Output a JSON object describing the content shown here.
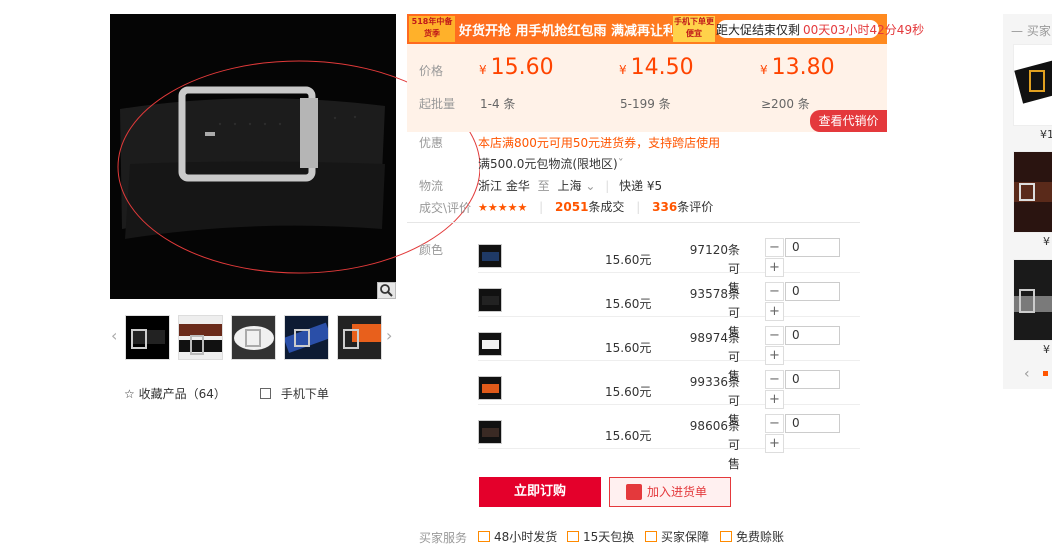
{
  "gallery": {
    "thumbnails": [
      "thumb-black-silver",
      "thumb-brown",
      "thumb-white",
      "thumb-blue",
      "thumb-orange"
    ],
    "favorite_label": "收藏产品（64）",
    "mobile_order_label": "手机下单"
  },
  "promo": {
    "tag_text": "518年中备货季",
    "slogan": "好货开抢 用手机抢红包雨 满减再让利!",
    "tag2_text": "手机下单更便宜",
    "countdown_label": "距大促结束仅剩",
    "countdown_time": "00天03小时42分49秒"
  },
  "pricing": {
    "price_label": "价格",
    "moq_label": "起批量",
    "currency": "¥",
    "tiers": [
      {
        "price": "15.60",
        "qty": "1-4 条"
      },
      {
        "price": "14.50",
        "qty": "5-199 条"
      },
      {
        "price": "13.80",
        "qty": "≥200 条"
      }
    ],
    "agent_button": "查看代销价"
  },
  "offers": {
    "label": "优惠",
    "coupon_text": "本店满800元可用50元进货券，支持跨店使用",
    "shipping_text": "满500.0元包物流(限地区)",
    "chevron": "ˇ"
  },
  "logistics": {
    "label": "物流",
    "origin": "浙江 金华",
    "to": "至",
    "destination": "上海",
    "dest_chevron": "⌄",
    "method": "快递 ¥5"
  },
  "deals": {
    "label": "成交\\评价",
    "stars": "★★★★★",
    "sold_count": "2051",
    "sold_suffix": "条成交",
    "review_count": "336",
    "review_suffix": "条评价"
  },
  "sku": {
    "label": "颜色",
    "unit_price_suffix": "元",
    "stock_suffix_1": "条可",
    "stock_suffix_2": "售",
    "rows": [
      {
        "color": "#1f3a66",
        "price": "15.60",
        "stock": "97120",
        "qty": "0"
      },
      {
        "color": "#222222",
        "price": "15.60",
        "stock": "93578",
        "qty": "0"
      },
      {
        "color": "#f2f2f2",
        "price": "15.60",
        "stock": "98974",
        "qty": "0"
      },
      {
        "color": "#e05a1a",
        "price": "15.60",
        "stock": "99336",
        "qty": "0"
      },
      {
        "color": "#3a2a24",
        "price": "15.60",
        "stock": "98606",
        "qty": "0"
      }
    ],
    "minus": "−",
    "plus": "+"
  },
  "actions": {
    "order_now": "立即订购",
    "add_to_cart": "加入进货单"
  },
  "services": {
    "label": "买家服务",
    "items": [
      "48小时发货",
      "15天包换",
      "买家保障",
      "免费赊账"
    ]
  },
  "rail": {
    "title": "买家",
    "prices": [
      "¥1",
      "¥",
      "¥"
    ]
  },
  "colors": {
    "accent": "#ff5500",
    "primary_red": "#e4002b"
  }
}
